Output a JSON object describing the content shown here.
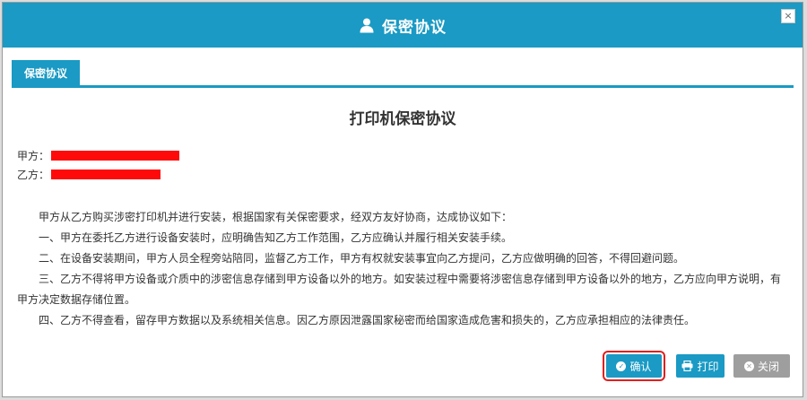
{
  "dialog": {
    "title": "保密协议",
    "title_icon": "user-icon",
    "close_glyph": "×"
  },
  "tabs": [
    {
      "label": "保密协议",
      "active": true
    }
  ],
  "document": {
    "title": "打印机保密协议",
    "party_a_label": "甲方：",
    "party_b_label": "乙方：",
    "paragraphs": [
      "甲方从乙方购买涉密打印机并进行安装，根据国家有关保密要求，经双方友好协商，达成协议如下：",
      "一、甲方在委托乙方进行设备安装时，应明确告知乙方工作范围，乙方应确认并履行相关安装手续。",
      "二、在设备安装期间，甲方人员全程旁站陪同，监督乙方工作，甲方有权就安装事宜向乙方提问，乙方应做明确的回答，不得回避问题。",
      "三、乙方不得将甲方设备或介质中的涉密信息存储到甲方设备以外的地方。如安装过程中需要将涉密信息存储到甲方设备以外的地方，乙方应向甲方说明，有甲方决定数据存储位置。",
      "四、乙方不得查看，留存甲方数据以及系统相关信息。因乙方原因泄露国家秘密而给国家造成危害和损失的，乙方应承担相应的法律责任。"
    ]
  },
  "buttons": {
    "confirm": "确认",
    "print": "打印",
    "close": "关闭"
  },
  "colors": {
    "accent": "#1a9ac4",
    "close_button": "#9e9e9e",
    "highlight_outline": "#e02020",
    "redaction": "#ff0a0a"
  }
}
